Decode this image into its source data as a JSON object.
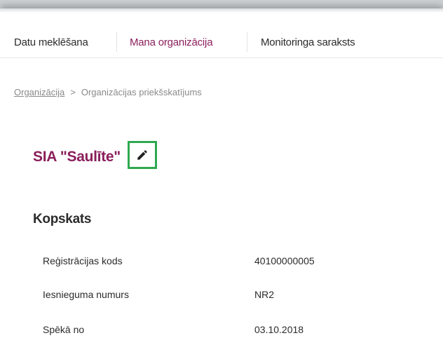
{
  "nav": {
    "tabs": [
      {
        "label": "Datu meklēšana"
      },
      {
        "label": "Mana organizācija"
      },
      {
        "label": "Monitoringa saraksts"
      }
    ]
  },
  "breadcrumb": {
    "link": "Organizācija",
    "separator": ">",
    "current": "Organizācijas priekšskatījums"
  },
  "organization": {
    "name": "SIA \"Saulīte\"",
    "edit_icon": "pencil-icon"
  },
  "overview": {
    "title": "Kopskats",
    "rows": [
      {
        "label": "Reģistrācijas kods",
        "value": "40100000005"
      },
      {
        "label": "Iesnieguma numurs",
        "value": "NR2"
      },
      {
        "label": "Spēkā no",
        "value": "03.10.2018"
      }
    ]
  },
  "colors": {
    "accent": "#8a1f5c",
    "highlight_box": "#2fa84f"
  }
}
